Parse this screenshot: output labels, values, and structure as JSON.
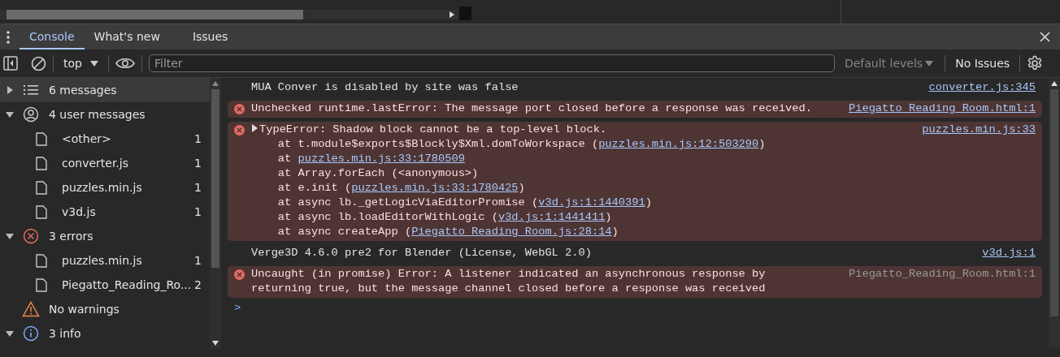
{
  "tabs": [
    {
      "label": "Console",
      "selected": true
    },
    {
      "label": "What's new",
      "selected": false
    },
    {
      "label": "Issues",
      "selected": false
    }
  ],
  "toolbar": {
    "context": "top",
    "filter": {
      "placeholder": "Filter"
    },
    "levels": {
      "label": "Default levels",
      "disabled": true
    },
    "issues": "No Issues"
  },
  "sidebar": {
    "items": [
      {
        "label": "6 messages",
        "kind": "list",
        "expanded": false,
        "selected": true
      },
      {
        "label": "4 user messages",
        "kind": "user",
        "expanded": true,
        "selected": false,
        "children": [
          {
            "label": "<other>",
            "count": "1"
          },
          {
            "label": "converter.js",
            "count": "1"
          },
          {
            "label": "puzzles.min.js",
            "count": "1"
          },
          {
            "label": "v3d.js",
            "count": "1"
          }
        ]
      },
      {
        "label": "3 errors",
        "kind": "error",
        "expanded": true,
        "selected": false,
        "children": [
          {
            "label": "puzzles.min.js",
            "count": "1"
          },
          {
            "label": "Piegatto_Reading_Ro...",
            "count": "2"
          }
        ]
      },
      {
        "label": "No warnings",
        "kind": "warning",
        "selected": false
      },
      {
        "label": "3 info",
        "kind": "info",
        "expanded": true,
        "selected": false
      }
    ]
  },
  "messages": [
    {
      "kind": "log",
      "lines": [
        [
          {
            "text": "MUA Conver is disabled by site was false"
          }
        ]
      ],
      "source": "converter.js:345",
      "source_link": true
    },
    {
      "kind": "error",
      "lines": [
        [
          {
            "text": "Unchecked runtime.lastError: The message port closed before a response was received."
          }
        ]
      ],
      "source": "Piegatto_Reading_Room.html:1",
      "source_link": true
    },
    {
      "kind": "error",
      "expandable": true,
      "lines": [
        [
          {
            "text": "TypeError: Shadow block cannot be a top-level block."
          }
        ],
        [
          {
            "text": "    at t.module$exports$Blockly$Xml.domToWorkspace ("
          },
          {
            "text": "puzzles.min.js:12:503290",
            "link": true
          },
          {
            "text": ")"
          }
        ],
        [
          {
            "text": "    at "
          },
          {
            "text": "puzzles.min.js:33:1780509",
            "link": true
          }
        ],
        [
          {
            "text": "    at Array.forEach (<anonymous>)"
          }
        ],
        [
          {
            "text": "    at e.init ("
          },
          {
            "text": "puzzles.min.js:33:1780425",
            "link": true
          },
          {
            "text": ")"
          }
        ],
        [
          {
            "text": "    at async lb._getLogicViaEditorPromise ("
          },
          {
            "text": "v3d.js:1:1440391",
            "link": true
          },
          {
            "text": ")"
          }
        ],
        [
          {
            "text": "    at async lb.loadEditorWithLogic ("
          },
          {
            "text": "v3d.js:1:1441411",
            "link": true
          },
          {
            "text": ")"
          }
        ],
        [
          {
            "text": "    at async createApp ("
          },
          {
            "text": "Piegatto_Reading_Room.js:28:14",
            "link": true
          },
          {
            "text": ")"
          }
        ]
      ],
      "source": "puzzles.min.js:33",
      "source_link": true
    },
    {
      "kind": "log",
      "lines": [
        [
          {
            "text": "Verge3D 4.6.0 pre2 for Blender (License, WebGL 2.0)"
          }
        ]
      ],
      "source": "v3d.js:1",
      "source_link": true
    },
    {
      "kind": "error",
      "lines": [
        [
          {
            "text": "Uncaught (in promise) Error: A listener indicated an asynchronous response by"
          }
        ],
        [
          {
            "text": "returning true, but the message channel closed before a response was received"
          }
        ]
      ],
      "source": "Piegatto_Reading_Room.html:1",
      "source_link": false
    }
  ],
  "prompt": ">"
}
